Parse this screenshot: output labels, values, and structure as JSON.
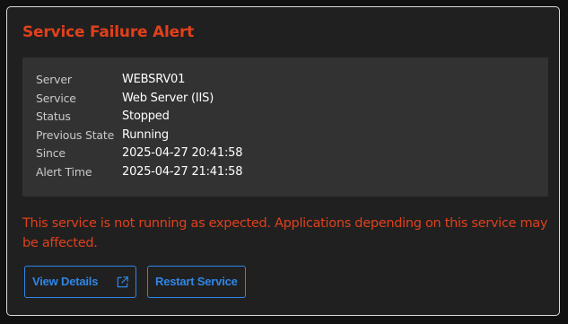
{
  "alert": {
    "title": "Service Failure Alert",
    "message": "This service is not running as expected. Applications depending on this service may be affected."
  },
  "details": [
    {
      "label": "Server",
      "value": "WEBSRV01"
    },
    {
      "label": "Service",
      "value": "Web Server (IIS)"
    },
    {
      "label": "Status",
      "value": "Stopped"
    },
    {
      "label": "Previous State",
      "value": "Running"
    },
    {
      "label": "Since",
      "value": "2025-04-27 20:41:58"
    },
    {
      "label": "Alert Time",
      "value": "2025-04-27 21:41:58"
    }
  ],
  "buttons": {
    "view_details": "View Details",
    "restart_service": "Restart Service"
  },
  "icons": {
    "view_details_icon": "external-link-icon"
  },
  "colors": {
    "alert_red": "#e0401c",
    "action_blue": "#2f86e6"
  }
}
